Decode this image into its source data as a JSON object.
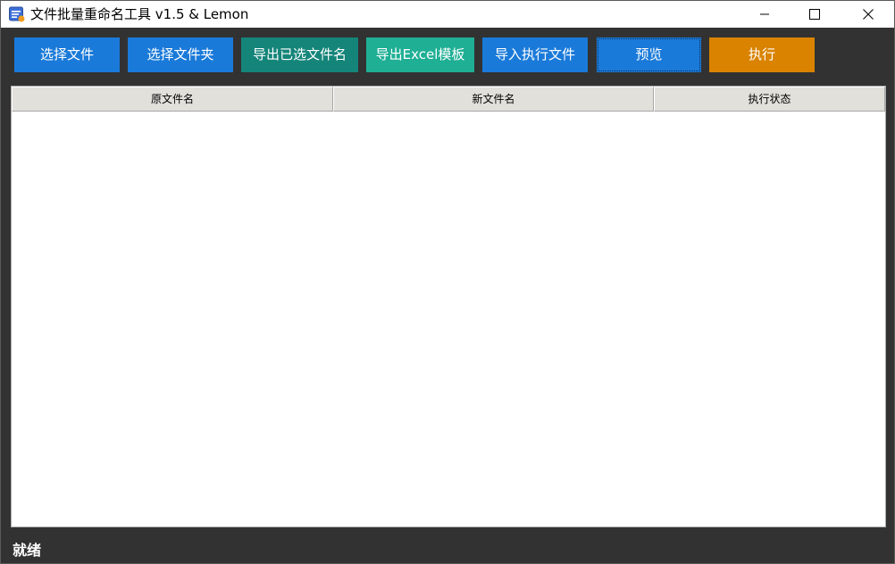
{
  "window": {
    "title": "文件批量重命名工具 v1.5 & Lemon",
    "icon": "app-icon"
  },
  "toolbar": {
    "select_files": "选择文件",
    "select_folder": "选择文件夹",
    "export_selected": "导出已选文件名",
    "export_excel_template": "导出Excel模板",
    "import_exec_file": "导入执行文件",
    "preview": "预览",
    "execute": "执行"
  },
  "table": {
    "columns": [
      "原文件名",
      "新文件名",
      "执行状态"
    ],
    "rows": []
  },
  "status_bar": {
    "text": "就绪"
  },
  "colors": {
    "blue": "#1a7ad9",
    "teal": "#15857a",
    "green": "#1faf95",
    "orange": "#d98300",
    "background": "#323232"
  }
}
